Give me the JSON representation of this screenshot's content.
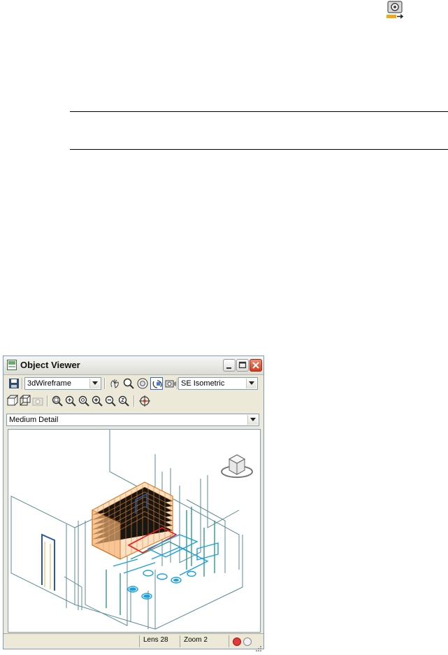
{
  "window": {
    "title": "Object Viewer",
    "visual_style": "3dWireframe",
    "view_direction": "SE Isometric",
    "detail_level": "Medium Detail"
  },
  "status": {
    "lens": "Lens 28",
    "zoom": "Zoom 2"
  },
  "icons": {
    "top": "save-camera-icon",
    "app": "object-viewer-icon"
  },
  "colors": {
    "brick": "#e07a1f",
    "mep": "#1aa0e0",
    "walls": "#3a9a8c"
  }
}
